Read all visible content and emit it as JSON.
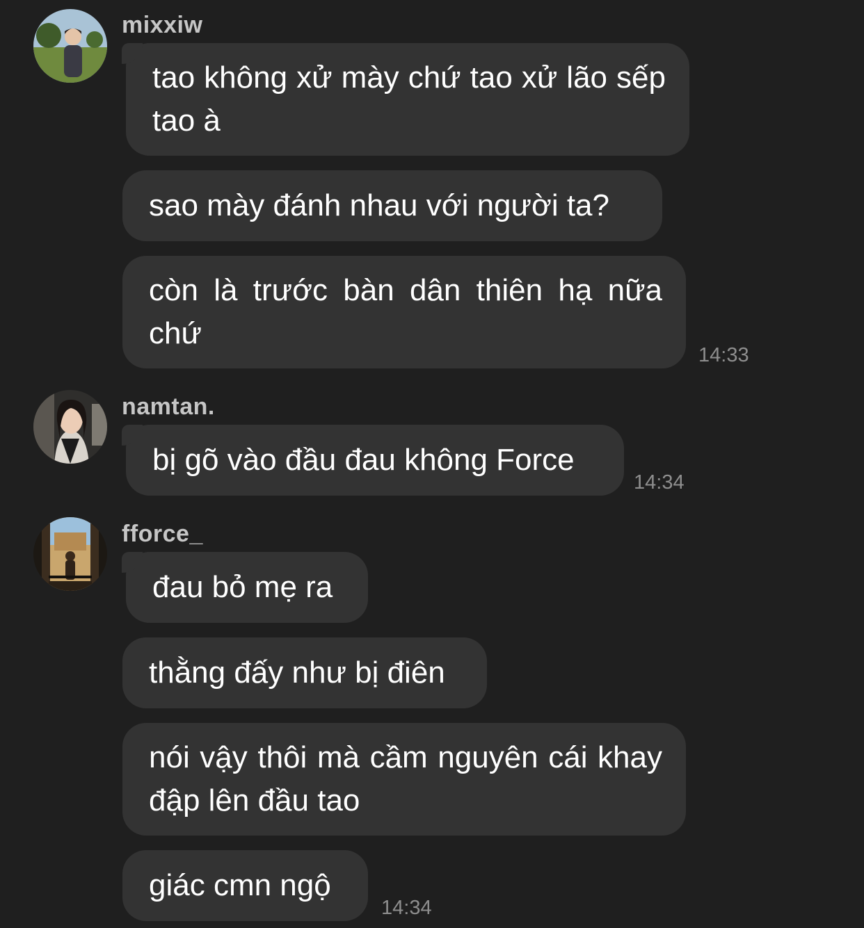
{
  "messages": [
    {
      "username": "mixxiw",
      "avatar": "avatar-mixxiw",
      "bubbles": [
        "tao không xử mày chứ tao xử lão sếp tao à",
        "sao mày đánh nhau với người ta?",
        "còn là trước bàn dân thiên hạ nữa chứ"
      ],
      "time": "14:33"
    },
    {
      "username": "namtan.",
      "avatar": "avatar-namtan",
      "bubbles": [
        "bị gõ vào đầu đau không Force"
      ],
      "time": "14:34"
    },
    {
      "username": "fforce_",
      "avatar": "avatar-fforce",
      "bubbles": [
        "đau bỏ mẹ ra",
        "thằng đấy như bị điên",
        "nói vậy thôi mà cầm nguyên cái khay đập lên đầu tao",
        "giác cmn ngộ"
      ],
      "time": "14:34"
    }
  ],
  "colors": {
    "background": "#1f1f1f",
    "bubble": "#333333",
    "text": "#ffffff",
    "username": "#c6c6c6",
    "timestamp": "#8e8e8e"
  }
}
